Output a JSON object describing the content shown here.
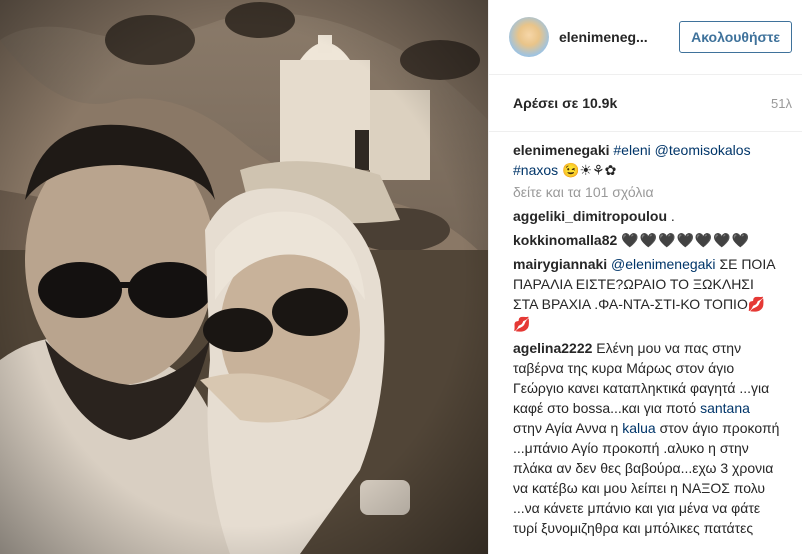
{
  "post": {
    "username": "elenimenegaki",
    "username_display": "elenimeneg...",
    "follow_label": "Ακολουθήστε",
    "likes": "Αρέσει σε 10.9k",
    "time": "51λ",
    "caption": {
      "user": "elenimenegaki",
      "tag1": "#eleni",
      "mention": "@teomisokalos",
      "tag2": "#naxos",
      "emoji": "😉☀⚘✿"
    },
    "view_all": "δείτε και τα 101 σχόλια",
    "comments": [
      {
        "user": "aggeliki_dimitropoulou",
        "text": "."
      },
      {
        "user": "kokkinomalla82",
        "text": "🖤🖤🖤🖤🖤🖤🖤"
      },
      {
        "user": "mairygiannaki",
        "mention": "@elenimenegaki",
        "text": "ΣΕ ΠΟΙΑ ΠΑΡΑΛΙΑ ΕΙΣΤΕ?ΩΡΑΙΟ ΤΟ ΞΩΚΛΗΣΙ ΣΤΑ ΒΡΑΧΙΑ .ΦΑ-ΝΤΑ-ΣΤΙ-ΚΟ ΤΟΠΙΟ💋💋"
      },
      {
        "user": "agelina2222",
        "text_a": "Ελένη μου να πας στην ταβέρνα της κυρα Μάρως στον άγιο Γεώργιο κανει καταπληκτικά φαγητά ...για καφέ στο bossa...και για ποτό",
        "link1": "santana",
        "text_b": "στην Αγία Αννα η",
        "link2": "kalua",
        "text_c": "στον άγιο προκοπή ...μπάνιο Αγίο προκοπή .αλυκο η στην πλάκα αν δεν θες βαβούρα...εχω 3 χρονια να κατέβω και μου λείπει η ΝΑΞΟΣ πολυ ...να κάνετε μπάνιο και για μένα να φάτε τυρί ξυνομιζηθρα και μπόλικες πατάτες"
      }
    ]
  }
}
